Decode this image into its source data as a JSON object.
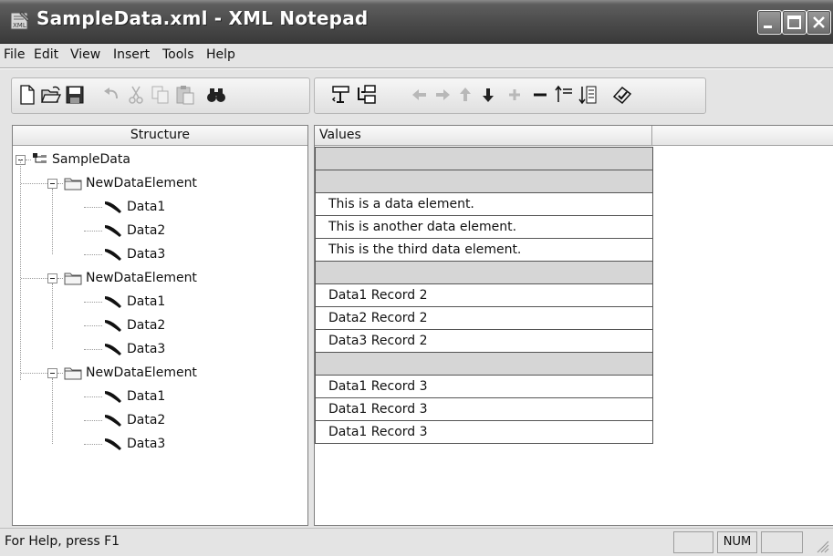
{
  "window": {
    "title": "SampleData.xml - XML Notepad"
  },
  "menu": [
    {
      "label": "File"
    },
    {
      "label": "Edit"
    },
    {
      "label": "View"
    },
    {
      "label": "Insert"
    },
    {
      "label": "Tools"
    },
    {
      "label": "Help"
    }
  ],
  "toolbar": {
    "buttons": [
      {
        "icon": "new-document-icon",
        "enabled": true
      },
      {
        "icon": "open-folder-icon",
        "enabled": true
      },
      {
        "icon": "save-disk-icon",
        "enabled": true
      },
      {
        "icon": "undo-icon",
        "enabled": false
      },
      {
        "icon": "cut-icon",
        "enabled": false
      },
      {
        "icon": "copy-icon",
        "enabled": false
      },
      {
        "icon": "paste-icon",
        "enabled": false
      },
      {
        "icon": "find-binoculars-icon",
        "enabled": true
      },
      {
        "icon": "insert-element-icon",
        "enabled": true
      },
      {
        "icon": "insert-child-icon",
        "enabled": true
      },
      {
        "icon": "move-left-icon",
        "enabled": false
      },
      {
        "icon": "move-right-icon",
        "enabled": false
      },
      {
        "icon": "move-up-icon",
        "enabled": false
      },
      {
        "icon": "move-down-icon",
        "enabled": true
      },
      {
        "icon": "expand-plus-icon",
        "enabled": false
      },
      {
        "icon": "collapse-minus-icon",
        "enabled": true
      },
      {
        "icon": "expand-all-icon",
        "enabled": true
      },
      {
        "icon": "collapse-all-icon",
        "enabled": true
      },
      {
        "icon": "validate-icon",
        "enabled": true
      }
    ]
  },
  "structure": {
    "header": "Structure",
    "rows": [
      {
        "label": "SampleData",
        "depth": 0,
        "kind": "root"
      },
      {
        "label": "NewDataElement",
        "depth": 1,
        "kind": "folder"
      },
      {
        "label": "Data1",
        "depth": 2,
        "kind": "leaf"
      },
      {
        "label": "Data2",
        "depth": 2,
        "kind": "leaf"
      },
      {
        "label": "Data3",
        "depth": 2,
        "kind": "leaf"
      },
      {
        "label": "NewDataElement",
        "depth": 1,
        "kind": "folder"
      },
      {
        "label": "Data1",
        "depth": 2,
        "kind": "leaf"
      },
      {
        "label": "Data2",
        "depth": 2,
        "kind": "leaf"
      },
      {
        "label": "Data3",
        "depth": 2,
        "kind": "leaf"
      },
      {
        "label": "NewDataElement",
        "depth": 1,
        "kind": "folder"
      },
      {
        "label": "Data1",
        "depth": 2,
        "kind": "leaf"
      },
      {
        "label": "Data2",
        "depth": 2,
        "kind": "leaf"
      },
      {
        "label": "Data3",
        "depth": 2,
        "kind": "leaf"
      }
    ]
  },
  "values": {
    "header": "Values",
    "rows": [
      {
        "text": "",
        "grey": true
      },
      {
        "text": "",
        "grey": true
      },
      {
        "text": "This is a data element.",
        "grey": false
      },
      {
        "text": "This is another data element.",
        "grey": false
      },
      {
        "text": "This is the third data element.",
        "grey": false
      },
      {
        "text": "",
        "grey": true
      },
      {
        "text": "Data1 Record 2",
        "grey": false
      },
      {
        "text": "Data2 Record 2",
        "grey": false
      },
      {
        "text": "Data3 Record 2",
        "grey": false
      },
      {
        "text": "",
        "grey": true
      },
      {
        "text": "Data1 Record 3",
        "grey": false
      },
      {
        "text": "Data1 Record 3",
        "grey": false
      },
      {
        "text": "Data1 Record 3",
        "grey": false
      }
    ]
  },
  "status": {
    "text": "For Help, press F1",
    "panels": [
      "",
      "NUM",
      ""
    ]
  }
}
